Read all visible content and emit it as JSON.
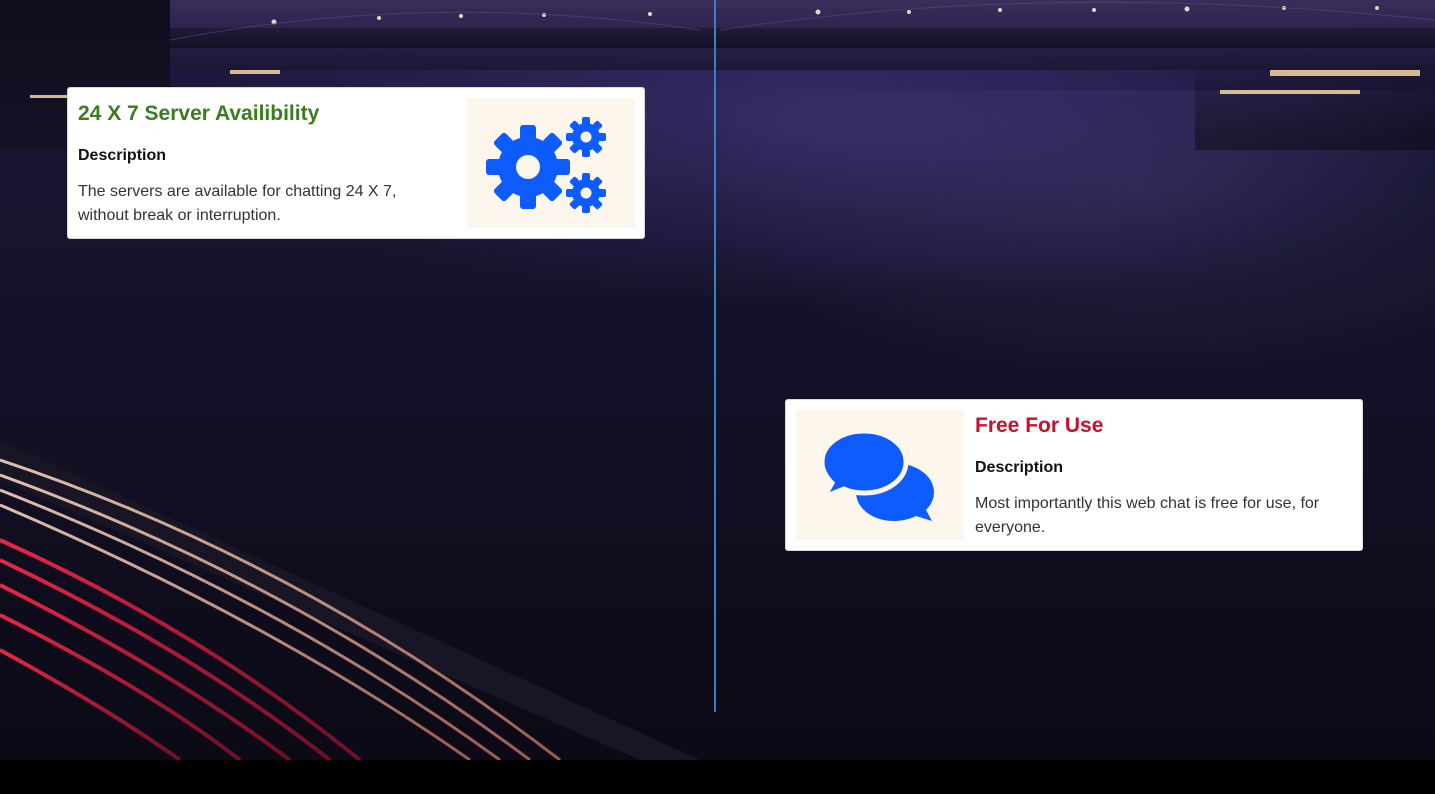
{
  "colors": {
    "title_green": "#3a7d1e",
    "title_red": "#c8102e",
    "icon_blue": "#0d5cff",
    "media_bg": "#fdf6ec",
    "timeline": "#3a7fc4"
  },
  "features": [
    {
      "title": "24 X 7 Server Availibility",
      "subtitle": "Description",
      "text": "The servers are available for chatting 24 X 7, without break or interruption.",
      "icon": "gears-icon"
    },
    {
      "title": "Free For Use",
      "subtitle": "Description",
      "text": "Most importantly this web chat is free for use, for everyone.",
      "icon": "chat-bubbles-icon"
    }
  ]
}
